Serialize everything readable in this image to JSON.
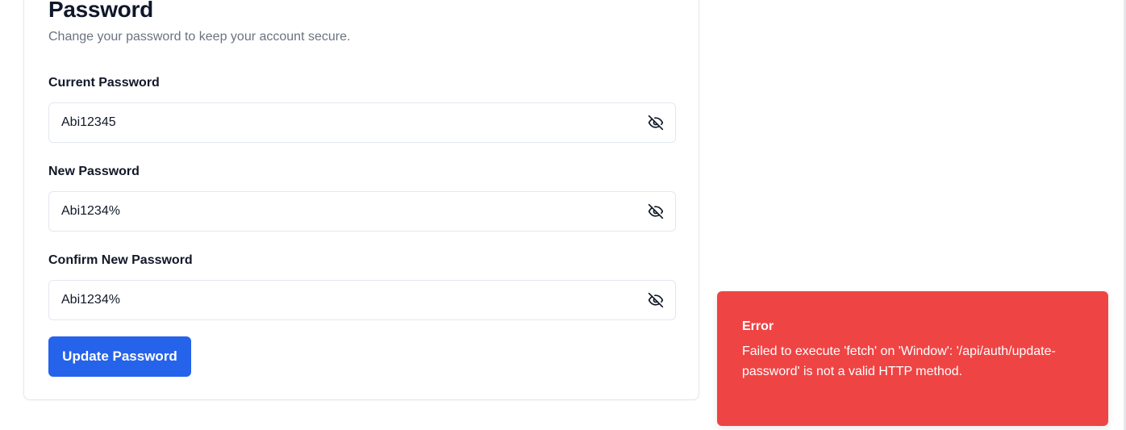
{
  "section": {
    "title": "Password",
    "subtitle": "Change your password to keep your account secure."
  },
  "fields": [
    {
      "label": "Current Password",
      "value": "Abi12345",
      "icon": "eye-off-icon"
    },
    {
      "label": "New Password",
      "value": "Abi1234%",
      "icon": "eye-off-icon"
    },
    {
      "label": "Confirm New Password",
      "value": "Abi1234%",
      "icon": "eye-off-icon"
    }
  ],
  "actions": {
    "update_label": "Update Password"
  },
  "toast": {
    "title": "Error",
    "message": "Failed to execute 'fetch' on 'Window': '/api/auth/update-password' is not a valid HTTP method."
  },
  "colors": {
    "primary": "#2563eb",
    "error": "#ef4444",
    "muted_text": "#6b7280",
    "border": "#e2e8f0"
  }
}
